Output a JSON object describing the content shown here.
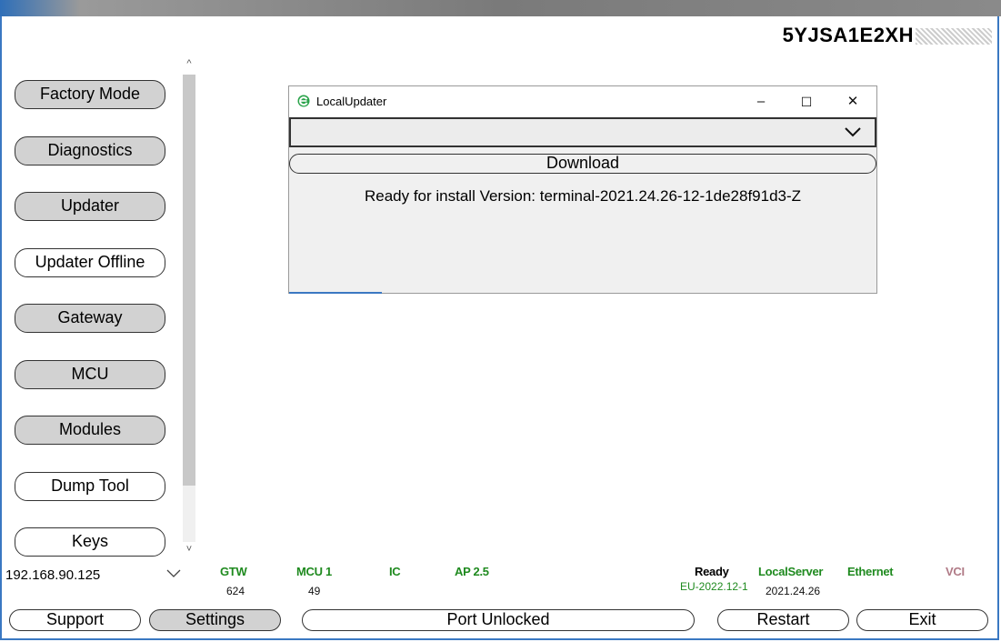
{
  "vin": {
    "text": "5YJSA1E2XH",
    "redacted": "redacted-scribble"
  },
  "sidebar": {
    "items": [
      {
        "label": "Factory Mode",
        "style": "gray"
      },
      {
        "label": "Diagnostics",
        "style": "gray"
      },
      {
        "label": "Updater",
        "style": "gray"
      },
      {
        "label": "Updater Offline",
        "style": "white"
      },
      {
        "label": "Gateway",
        "style": "gray"
      },
      {
        "label": "MCU",
        "style": "gray"
      },
      {
        "label": "Modules",
        "style": "gray"
      },
      {
        "label": "Dump Tool",
        "style": "white"
      },
      {
        "label": "Keys",
        "style": "white"
      }
    ],
    "scroll_up": "^",
    "scroll_down": "˅"
  },
  "dialog": {
    "title": "LocalUpdater",
    "icon": "edge-style-e-icon",
    "minimize": "–",
    "maximize": "☐",
    "close": "✕",
    "dropdown_value": "",
    "download_label": "Download",
    "message": "Ready for install Version: terminal-2021.24.26-12-1de28f91d3-Z"
  },
  "connection": {
    "ip": "192.168.90.125"
  },
  "status": {
    "gtw": {
      "label": "GTW",
      "value": "624"
    },
    "mcu1": {
      "label": "MCU 1",
      "value": "49"
    },
    "ic": {
      "label": "IC"
    },
    "ap": {
      "label": "AP 2.5"
    },
    "ready": {
      "label": "Ready",
      "value": "EU-2022.12-1"
    },
    "localserver": {
      "label": "LocalServer",
      "value": "2021.24.26"
    },
    "ethernet": {
      "label": "Ethernet"
    },
    "vci": {
      "label": "VCI"
    }
  },
  "colors": {
    "accent": "#3a78c2",
    "ok": "#1f8a1f",
    "vci": "#b07a86",
    "button_gray": "#d2d2d2"
  },
  "footer": {
    "support": "Support",
    "settings": "Settings",
    "port": "Port Unlocked",
    "restart": "Restart",
    "exit": "Exit"
  }
}
